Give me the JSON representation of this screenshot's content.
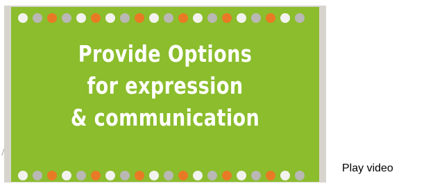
{
  "video": {
    "title_lines": [
      "Provide Options",
      "for expression",
      "& communication"
    ],
    "play_label": "Play video",
    "thumbnail_icon": "video-thumbnail-image"
  },
  "colors": {
    "frame": "#d7d4ce",
    "slide_background": "#8bbd2c",
    "dot_white": "#f2f2ee",
    "dot_gray": "#b9b8b4",
    "dot_orange": "#e97a25",
    "text": "#ffffff"
  },
  "dots": {
    "top_pattern": [
      "white",
      "gray",
      "orange",
      "gray",
      "white",
      "orange",
      "white",
      "gray",
      "orange",
      "white",
      "gray",
      "orange",
      "white",
      "gray",
      "orange",
      "white",
      "gray",
      "orange",
      "white",
      "gray"
    ],
    "bottom_pattern": [
      "white",
      "gray",
      "orange",
      "white",
      "gray",
      "orange",
      "white",
      "gray",
      "orange",
      "white",
      "gray",
      "orange",
      "white",
      "gray",
      "orange",
      "white",
      "gray",
      "orange",
      "white",
      "gray"
    ]
  }
}
